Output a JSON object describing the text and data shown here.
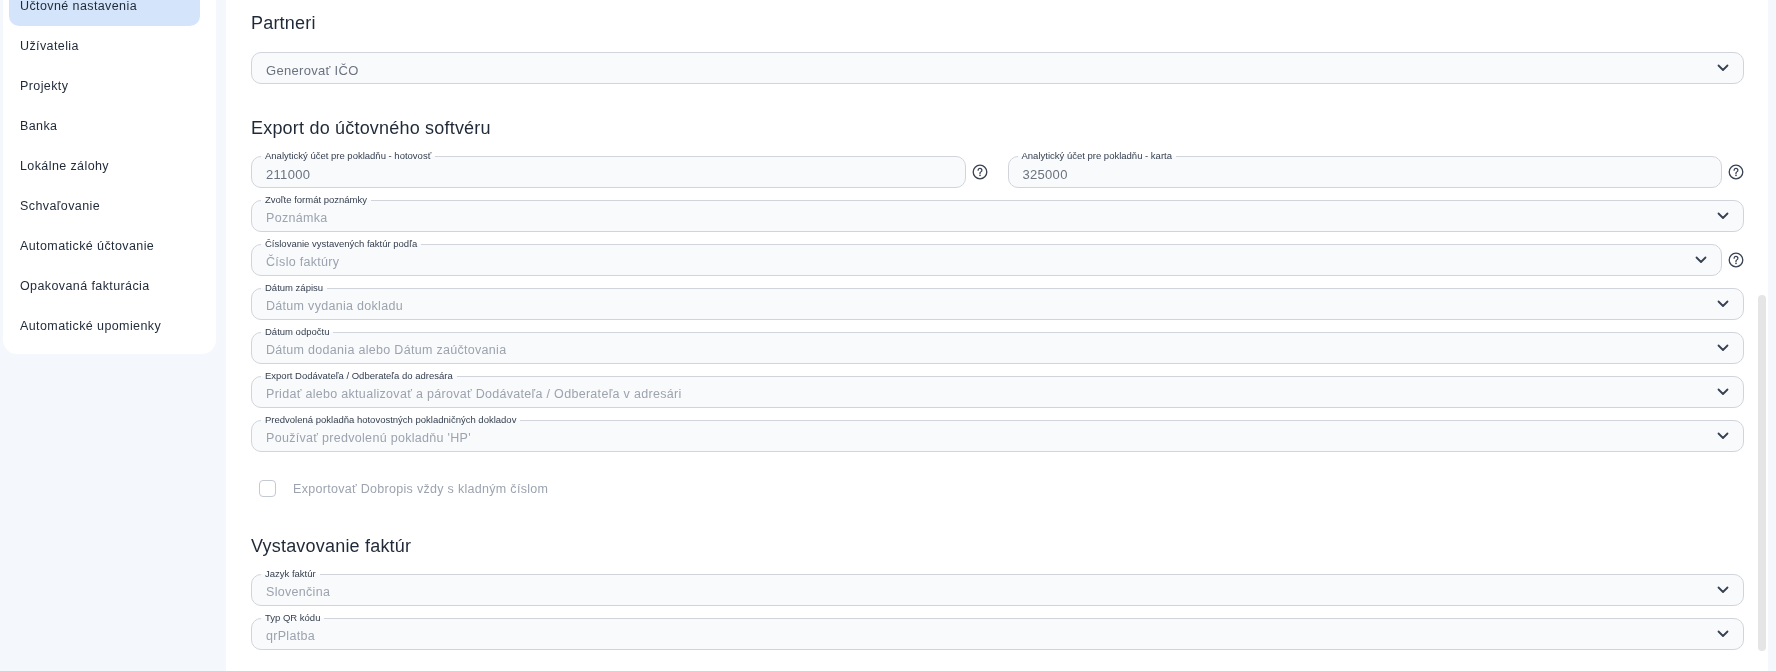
{
  "sidebar": {
    "items": [
      {
        "label": "Účtovné nastavenia",
        "selected": true
      },
      {
        "label": "Užívatelia",
        "selected": false
      },
      {
        "label": "Projekty",
        "selected": false
      },
      {
        "label": "Banka",
        "selected": false
      },
      {
        "label": "Lokálne zálohy",
        "selected": false
      },
      {
        "label": "Schvaľovanie",
        "selected": false
      },
      {
        "label": "Automatické účtovanie",
        "selected": false
      },
      {
        "label": "Opakovaná fakturácia",
        "selected": false
      },
      {
        "label": "Automatické upomienky",
        "selected": false
      }
    ]
  },
  "sections": [
    {
      "title": "Partneri",
      "rows": [
        {
          "kind": "select",
          "value": "Generovať IČO",
          "help": false
        }
      ]
    },
    {
      "title": "Export do účtovného softvéru",
      "rows": [
        {
          "kind": "inputs",
          "fields": [
            {
              "label": "Analytický účet pre pokladňu - hotovosť",
              "value": "211000",
              "help": true
            },
            {
              "label": "Analytický účet pre pokladňu - karta",
              "value": "325000",
              "help": true
            }
          ]
        },
        {
          "kind": "select",
          "label": "Zvoľte formát poznámky",
          "value": "Poznámka",
          "help": false
        },
        {
          "kind": "select",
          "label": "Číslovanie vystavených faktúr podľa",
          "value": "Číslo faktúry",
          "help": true
        },
        {
          "kind": "select",
          "label": "Dátum zápisu",
          "value": "Dátum vydania dokladu",
          "help": false
        },
        {
          "kind": "select",
          "label": "Dátum odpočtu",
          "value": "Dátum dodania alebo Dátum zaúčtovania",
          "help": false
        },
        {
          "kind": "select",
          "label": "Export Dodávateľa / Odberateľa do adresára",
          "value": "Pridať alebo aktualizovať a párovať Dodávateľa / Odberateľa v adresári",
          "help": false
        },
        {
          "kind": "select",
          "label": "Predvolená pokladňa hotovostných pokladničných dokladov",
          "value": "Používať predvolenú pokladňu 'HP'",
          "help": false
        },
        {
          "kind": "checkbox",
          "label": "Exportovať Dobropis vždy s kladným číslom",
          "checked": false
        }
      ]
    },
    {
      "title": "Vystavovanie faktúr",
      "rows": [
        {
          "kind": "select",
          "label": "Jazyk faktúr",
          "value": "Slovenčina",
          "help": false
        },
        {
          "kind": "select",
          "label": "Typ QR kódu",
          "value": "qrPlatba",
          "help": false
        }
      ]
    }
  ]
}
